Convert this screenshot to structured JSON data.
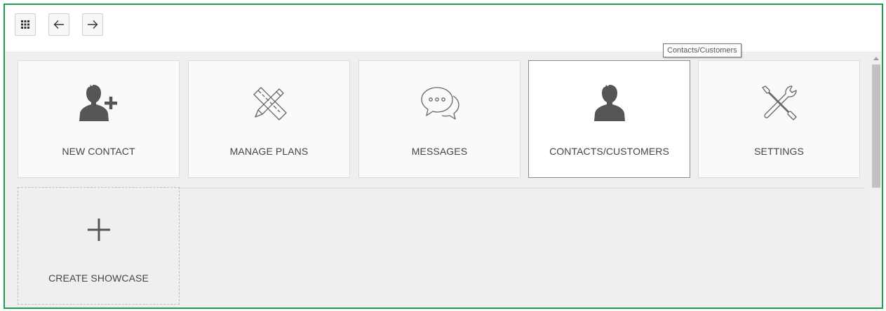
{
  "toolbar": {
    "apps_icon": "grid-icon",
    "back_icon": "arrow-left-icon",
    "forward_icon": "arrow-right-icon"
  },
  "tiles": [
    {
      "label": "NEW CONTACT",
      "icon": "add-person-icon"
    },
    {
      "label": "MANAGE PLANS",
      "icon": "pencil-ruler-icon"
    },
    {
      "label": "MESSAGES",
      "icon": "chat-bubbles-icon"
    },
    {
      "label": "CONTACTS/CUSTOMERS",
      "icon": "person-icon"
    },
    {
      "label": "SETTINGS",
      "icon": "tools-icon"
    }
  ],
  "create_tile": {
    "label": "CREATE SHOWCASE",
    "icon": "plus-icon"
  },
  "tooltip": "Contacts/Customers",
  "colors": {
    "frame_border": "#17a14a",
    "icon": "#555555",
    "background": "#efefef"
  }
}
